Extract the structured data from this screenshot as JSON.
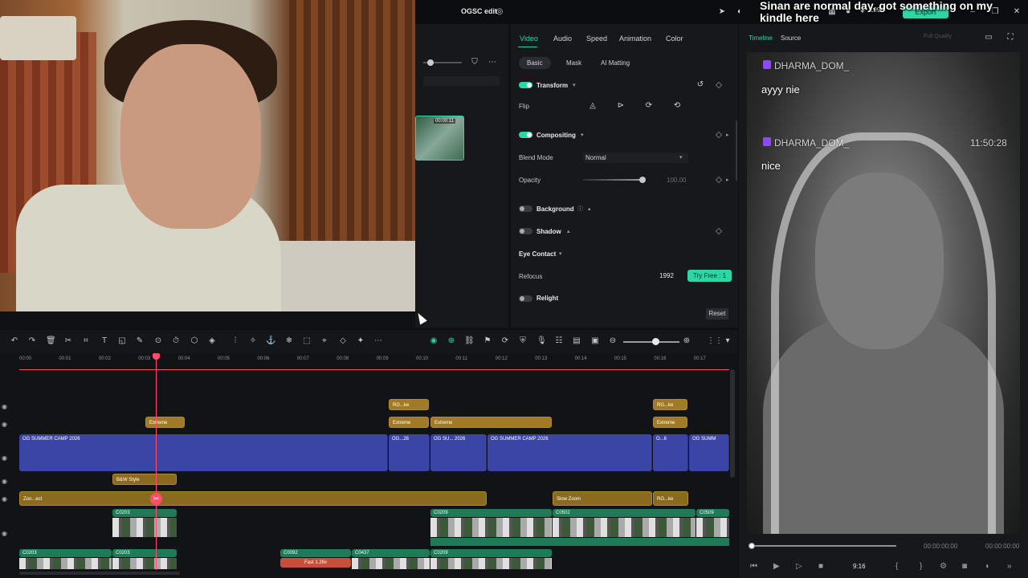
{
  "window": {
    "project_title": "OGSC edit",
    "overlay_text": "Sinan are normal day, got something on my kindle here",
    "credits": "1992",
    "export_label": "Export"
  },
  "media": {
    "clip_duration": "00:00:11"
  },
  "props": {
    "tabs": [
      "Video",
      "Audio",
      "Speed",
      "Animation",
      "Color"
    ],
    "subtabs": [
      "Basic",
      "Mask",
      "AI Matting"
    ],
    "transform": "Transform",
    "flip": "Flip",
    "compositing": "Compositing",
    "blend_mode_label": "Blend Mode",
    "blend_mode_value": "Normal",
    "opacity_label": "Opacity",
    "opacity_value": "100.00",
    "background": "Background",
    "shadow": "Shadow",
    "eye_contact": "Eye Contact",
    "refocus": "Refocus",
    "refocus_credits": "1992",
    "try_free": "Try Free : 1",
    "relight": "Relight",
    "reset": "Reset"
  },
  "preview": {
    "tabs": [
      "Timeline",
      "Source"
    ],
    "quality": "Full Quality",
    "chat": [
      {
        "name": "DHARMA_DOM_",
        "message": "ayyy nie"
      },
      {
        "name": "DHARMA_DOM_",
        "time": "11:50:28",
        "message": "nice"
      }
    ],
    "time_current": "00:00:00:00",
    "time_total": "00:00:00:00",
    "aspect": "9:16"
  },
  "timeline": {
    "ticks": [
      "00:00",
      "00:01",
      "00:02",
      "00:03",
      "00:04",
      "00:05",
      "00:06",
      "00:07",
      "00:08",
      "00:09",
      "00:10",
      "00:11",
      "00:12",
      "00:13",
      "00:14",
      "00:15",
      "00:16",
      "00:17"
    ],
    "clips": {
      "rg1": "RG...ke",
      "rg2": "RG...ke",
      "rg3": "RG...ke",
      "ext1": "Extreme",
      "ext2": "Extreme",
      "ext3": "Extreme",
      "ext4": "Extreme",
      "main1": "OG SUMMER CAMP 2026",
      "main2": "OG...26",
      "main3": "OG SU... 2026",
      "main4": "OG SUMMER CAMP 2026",
      "main5": "O...6",
      "main6": "OG SUMM",
      "bw": "B&W Style",
      "zoo": "Zoo...ect",
      "slowzoom": "Slow Zoom",
      "c0203a": "C0203",
      "c0209a": "C0209",
      "c0502": "C0502",
      "c0509": "C0509",
      "c0203b": "C0203",
      "c0203c": "C0203",
      "c0092": "C0092",
      "c0437": "C0437",
      "c0209b": "C0209",
      "fast": "Fast 1.26x"
    }
  }
}
